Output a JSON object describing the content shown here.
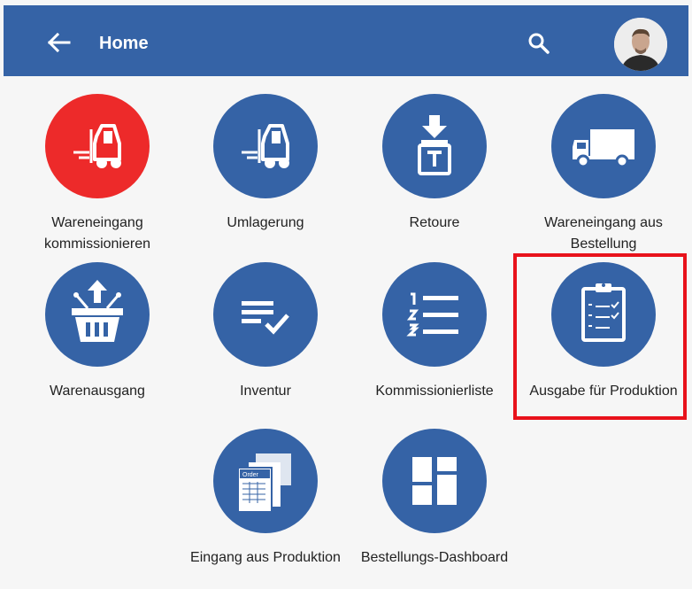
{
  "appbar": {
    "title": "Home"
  },
  "tiles": [
    {
      "label": "Wareneingang kommissionieren",
      "icon": "forklift-icon"
    },
    {
      "label": "Umlagerung",
      "icon": "forklift-icon"
    },
    {
      "label": "Retoure",
      "icon": "return-icon"
    },
    {
      "label": "Wareneingang aus Bestellung",
      "icon": "truck-icon"
    },
    {
      "label": "Warenausgang",
      "icon": "basket-upload-icon"
    },
    {
      "label": "Inventur",
      "icon": "list-check-icon"
    },
    {
      "label": "Kommissionierliste",
      "icon": "numbered-list-icon"
    },
    {
      "label": "Ausgabe für Produktion",
      "icon": "clipboard-checklist-icon"
    },
    {
      "label": "Eingang aus Produktion",
      "icon": "order-document-icon"
    },
    {
      "label": "Bestellungs-Dashboard",
      "icon": "dashboard-icon"
    }
  ],
  "order_icon_text": "Order",
  "colors": {
    "primary": "#3563a6",
    "accent_red": "#ed2a2a",
    "highlight": "#e8121b"
  }
}
